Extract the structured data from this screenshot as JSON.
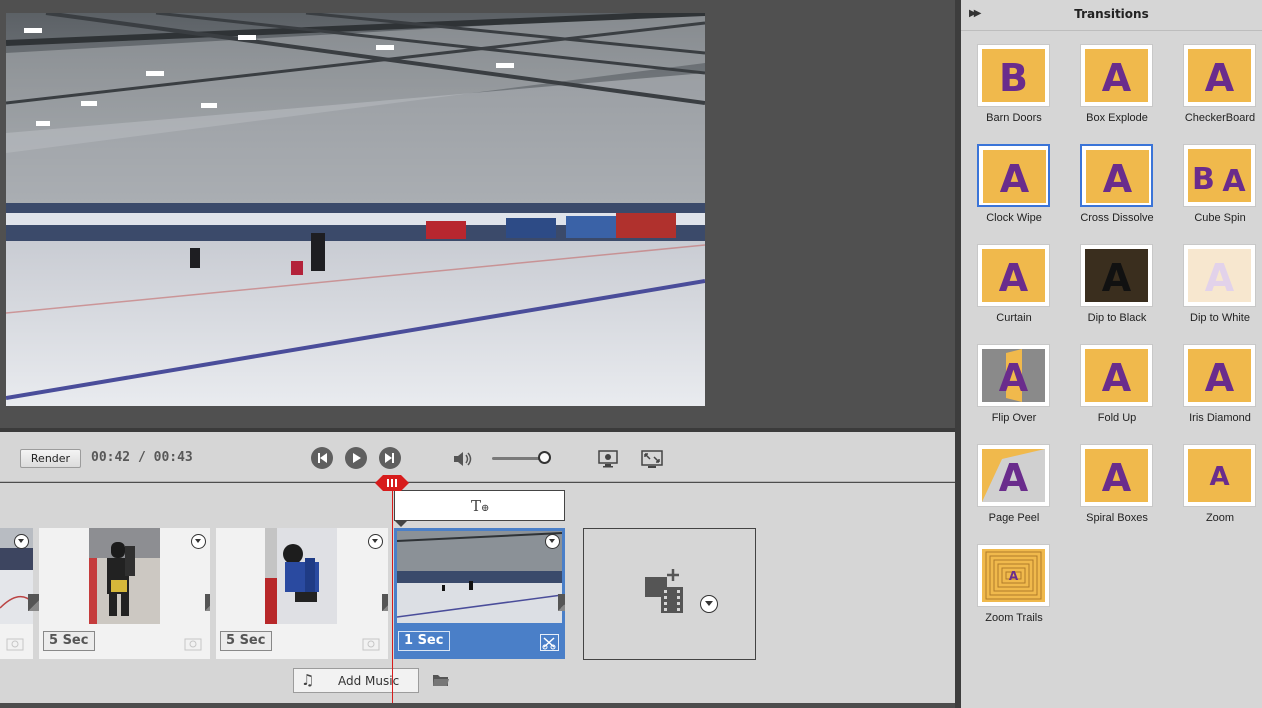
{
  "preview": {
    "image_desc_icon": "video-frame-ice-rink"
  },
  "controls": {
    "render_label": "Render",
    "timecode": "00:42 / 00:43",
    "volume_level": 0.85
  },
  "timeline": {
    "clips": [
      {
        "duration": ""
      },
      {
        "duration": "5 Sec"
      },
      {
        "duration": "5 Sec"
      },
      {
        "duration": "1 Sec"
      }
    ],
    "add_music_label": "Add Music"
  },
  "transitions": {
    "title": "Transitions",
    "items": [
      {
        "label": "Barn Doors",
        "icon": "barn-doors-icon",
        "selected": false
      },
      {
        "label": "Box Explode",
        "icon": "box-explode-icon",
        "selected": false
      },
      {
        "label": "CheckerBoard",
        "icon": "checkerboard-icon",
        "selected": false
      },
      {
        "label": "Clock Wipe",
        "icon": "clock-wipe-icon",
        "selected": true
      },
      {
        "label": "Cross Dissolve",
        "icon": "cross-dissolve-icon",
        "selected": true
      },
      {
        "label": "Cube Spin",
        "icon": "cube-spin-icon",
        "selected": false
      },
      {
        "label": "Curtain",
        "icon": "curtain-icon",
        "selected": false
      },
      {
        "label": "Dip to Black",
        "icon": "dip-to-black-icon",
        "selected": false
      },
      {
        "label": "Dip to White",
        "icon": "dip-to-white-icon",
        "selected": false
      },
      {
        "label": "Flip Over",
        "icon": "flip-over-icon",
        "selected": false
      },
      {
        "label": "Fold Up",
        "icon": "fold-up-icon",
        "selected": false
      },
      {
        "label": "Iris Diamond",
        "icon": "iris-diamond-icon",
        "selected": false
      },
      {
        "label": "Page Peel",
        "icon": "page-peel-icon",
        "selected": false
      },
      {
        "label": "Spiral Boxes",
        "icon": "spiral-boxes-icon",
        "selected": false
      },
      {
        "label": "Zoom",
        "icon": "zoom-icon",
        "selected": false
      },
      {
        "label": "Zoom Trails",
        "icon": "zoom-trails-icon",
        "selected": false
      }
    ]
  },
  "colors": {
    "accent_blue": "#3a74d8",
    "selected_clip": "#4a7fc8",
    "playhead_red": "#d71c1c",
    "thumb_orange": "#f0b94c",
    "thumb_letter": "#6a2c8c"
  }
}
